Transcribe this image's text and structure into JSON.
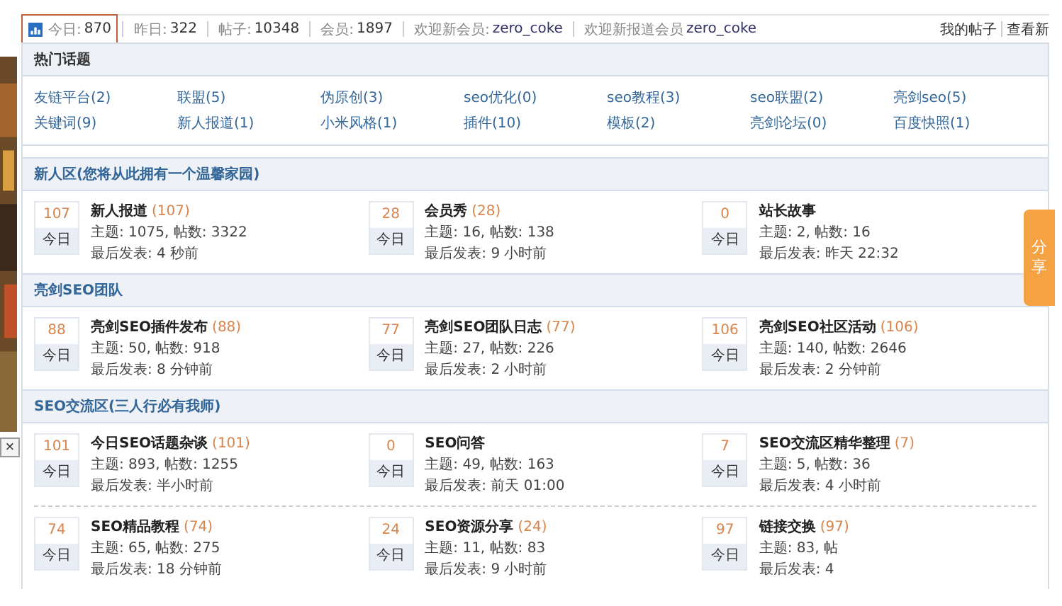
{
  "stats": [
    {
      "label": "今日:",
      "value": "870",
      "highlighted": true
    },
    {
      "label": "昨日:",
      "value": "322",
      "highlighted": false
    },
    {
      "label": "帖子:",
      "value": "10348",
      "highlighted": false
    },
    {
      "label": "会员:",
      "value": "1897",
      "highlighted": false
    },
    {
      "label": "欢迎新会员:",
      "value": "zero_coke",
      "highlighted": false
    },
    {
      "label": "欢迎新报道会员",
      "value": "zero_coke",
      "highlighted": false
    }
  ],
  "links": [
    "我的帖子",
    "查看新"
  ],
  "hot_topics": {
    "title": "热门话题",
    "items": [
      "友链平台(2)",
      "联盟(5)",
      "伪原创(3)",
      "seo优化(0)",
      "seo教程(3)",
      "seo联盟(2)",
      "亮剑seo(5)",
      "关键词(9)",
      "新人报道(1)",
      "小米风格(1)",
      "插件(10)",
      "模板(2)",
      "亮剑论坛(0)",
      "百度快照(1)"
    ]
  },
  "sections": [
    {
      "title": "新人区(您将从此拥有一个温馨家园)",
      "rows": [
        [
          {
            "name": "新人报道",
            "count": "(107)",
            "today": "107",
            "today_label": "今日",
            "stats": "主题: 1075, 帖数: 3322",
            "last_post": "最后发表: 4 秒前"
          },
          {
            "name": "会员秀",
            "count": "(28)",
            "today": "28",
            "today_label": "今日",
            "stats": "主题: 16, 帖数: 138",
            "last_post": "最后发表: 9 小时前"
          },
          {
            "name": "站长故事",
            "today": "0",
            "today_label": "今日",
            "stats": "主题: 2, 帖数: 16",
            "last_post": "最后发表: 昨天 22:32"
          }
        ]
      ]
    },
    {
      "title": "亮剑SEO团队",
      "rows": [
        [
          {
            "name": "亮剑SEO插件发布",
            "count": "(88)",
            "today": "88",
            "today_label": "今日",
            "stats": "主题: 50, 帖数: 918",
            "last_post": "最后发表: 8 分钟前"
          },
          {
            "name": "亮剑SEO团队日志",
            "count": "(77)",
            "today": "77",
            "today_label": "今日",
            "stats": "主题: 27, 帖数: 226",
            "last_post": "最后发表: 2 小时前"
          },
          {
            "name": "亮剑SEO社区活动",
            "count": "(106)",
            "today": "106",
            "today_label": "今日",
            "stats": "主题: 140, 帖数: 2646",
            "last_post": "最后发表: 2 分钟前"
          }
        ]
      ]
    },
    {
      "title": "SEO交流区(三人行必有我师)",
      "rows": [
        [
          {
            "name": "今日SEO话题杂谈",
            "count": "(101)",
            "today": "101",
            "today_label": "今日",
            "stats": "主题: 893, 帖数: 1255",
            "last_post": "最后发表: 半小时前"
          },
          {
            "name": "SEO问答",
            "today": "0",
            "today_label": "今日",
            "stats": "主题: 49, 帖数: 163",
            "last_post": "最后发表: 前天 01:00"
          },
          {
            "name": "SEO交流区精华整理",
            "count": "(7)",
            "today": "7",
            "today_label": "今日",
            "stats": "主题: 5, 帖数: 36",
            "last_post": "最后发表: 4 小时前"
          }
        ],
        [
          {
            "name": "SEO精品教程",
            "count": "(74)",
            "today": "74",
            "today_label": "今日",
            "stats": "主题: 65, 帖数: 275",
            "last_post": "最后发表: 18 分钟前"
          },
          {
            "name": "SEO资源分享",
            "count": "(24)",
            "today": "24",
            "today_label": "今日",
            "stats": "主题: 11, 帖数: 83",
            "last_post": "最后发表: 9 小时前"
          },
          {
            "name": "链接交换",
            "count": "(97)",
            "today": "97",
            "today_label": "今日",
            "stats": "主题: 83, 帖",
            "last_post": "最后发表: 4"
          }
        ]
      ]
    }
  ],
  "share_tab": "分享",
  "close_button": "×"
}
